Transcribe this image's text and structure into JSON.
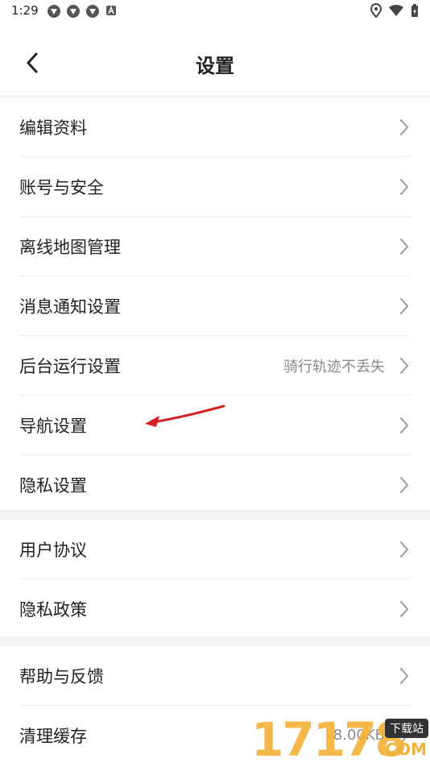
{
  "status_bar": {
    "time": "1:29",
    "left_icons": [
      "app-icon",
      "app-icon",
      "app-icon",
      "a-icon"
    ],
    "right_icons": [
      "location-icon",
      "wifi-icon",
      "battery-icon"
    ]
  },
  "header": {
    "title": "设置",
    "back_icon": "chevron-left-icon"
  },
  "groups": [
    {
      "items": [
        {
          "label": "编辑资料",
          "value": ""
        },
        {
          "label": "账号与安全",
          "value": ""
        },
        {
          "label": "离线地图管理",
          "value": ""
        },
        {
          "label": "消息通知设置",
          "value": ""
        },
        {
          "label": "后台运行设置",
          "value": "骑行轨迹不丢失"
        },
        {
          "label": "导航设置",
          "value": ""
        },
        {
          "label": "隐私设置",
          "value": ""
        }
      ]
    },
    {
      "items": [
        {
          "label": "用户协议",
          "value": ""
        },
        {
          "label": "隐私政策",
          "value": ""
        }
      ]
    },
    {
      "items": [
        {
          "label": "帮助与反馈",
          "value": ""
        },
        {
          "label": "清理缓存",
          "value": "8.00KB"
        }
      ]
    }
  ],
  "watermark": {
    "digits": "17178",
    "badge": "下载站",
    "domain": ".COM"
  },
  "colors": {
    "annotation_arrow": "#d42020",
    "watermark": "#f2b23a"
  }
}
